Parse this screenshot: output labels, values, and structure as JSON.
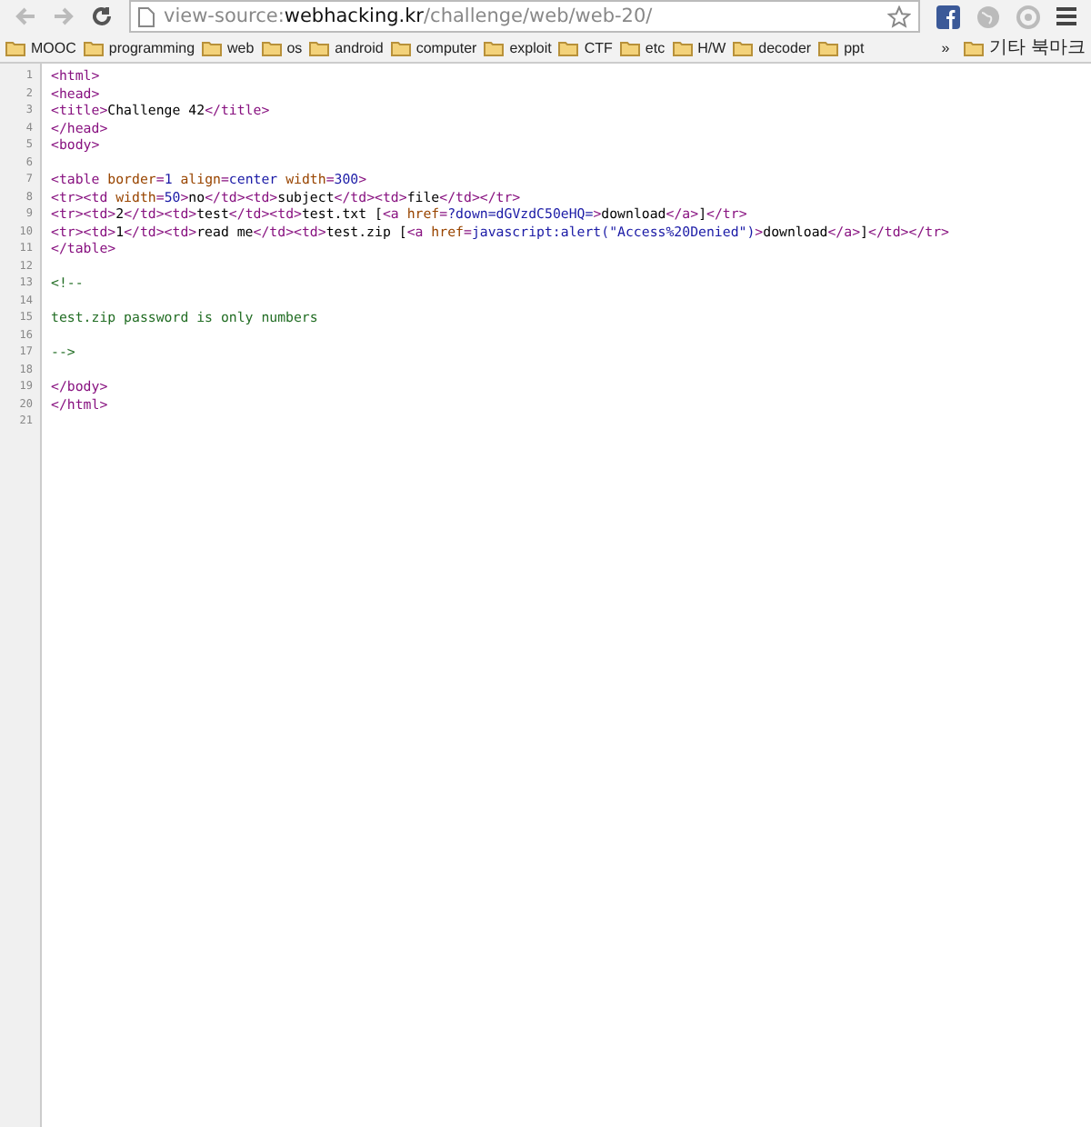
{
  "toolbar": {
    "address_scheme": "view-source:",
    "address_host": "webhacking.kr",
    "address_path": "/challenge/web/web-20/"
  },
  "bookmarks": [
    "MOOC",
    "programming",
    "web",
    "os",
    "android",
    "computer",
    "exploit",
    "CTF",
    "etc",
    "H/W",
    "decoder",
    "ppt"
  ],
  "bookmarks_overflow": "»",
  "other_bookmarks": "기타 북마크",
  "source_lines": [
    {
      "number": "1",
      "segments": [
        {
          "kind": "tag",
          "text": "<html>"
        }
      ]
    },
    {
      "number": "2",
      "segments": [
        {
          "kind": "tag",
          "text": "<head>"
        }
      ]
    },
    {
      "number": "3",
      "segments": [
        {
          "kind": "tag",
          "text": "<title>"
        },
        {
          "kind": "text",
          "text": "Challenge 42"
        },
        {
          "kind": "tag",
          "text": "</title>"
        }
      ]
    },
    {
      "number": "4",
      "segments": [
        {
          "kind": "tag",
          "text": "</head>"
        }
      ]
    },
    {
      "number": "5",
      "segments": [
        {
          "kind": "tag",
          "text": "<body>"
        }
      ]
    },
    {
      "number": "6"
    },
    {
      "number": "7",
      "segments": [
        {
          "kind": "tag",
          "text": "<table "
        },
        {
          "kind": "attr",
          "text": "border"
        },
        {
          "kind": "tag",
          "text": "="
        },
        {
          "kind": "value",
          "text": "1"
        },
        {
          "kind": "attr",
          "text": " align"
        },
        {
          "kind": "tag",
          "text": "="
        },
        {
          "kind": "value",
          "text": "center"
        },
        {
          "kind": "attr",
          "text": " width"
        },
        {
          "kind": "tag",
          "text": "="
        },
        {
          "kind": "value",
          "text": "300"
        },
        {
          "kind": "tag",
          "text": ">"
        }
      ]
    },
    {
      "number": "8",
      "segments": [
        {
          "kind": "tag",
          "text": "<tr><td "
        },
        {
          "kind": "attr",
          "text": "width"
        },
        {
          "kind": "tag",
          "text": "="
        },
        {
          "kind": "value",
          "text": "50"
        },
        {
          "kind": "tag",
          "text": ">"
        },
        {
          "kind": "text",
          "text": "no"
        },
        {
          "kind": "tag",
          "text": "</td><td>"
        },
        {
          "kind": "text",
          "text": "subject"
        },
        {
          "kind": "tag",
          "text": "</td><td>"
        },
        {
          "kind": "text",
          "text": "file"
        },
        {
          "kind": "tag",
          "text": "</td></tr>"
        }
      ]
    },
    {
      "number": "9",
      "segments": [
        {
          "kind": "tag",
          "text": "<tr><td>"
        },
        {
          "kind": "text",
          "text": "2"
        },
        {
          "kind": "tag",
          "text": "</td><td>"
        },
        {
          "kind": "text",
          "text": "test"
        },
        {
          "kind": "tag",
          "text": "</td><td>"
        },
        {
          "kind": "text",
          "text": "test.txt ["
        },
        {
          "kind": "tag",
          "text": "<a "
        },
        {
          "kind": "attr",
          "text": "href"
        },
        {
          "kind": "tag",
          "text": "="
        },
        {
          "kind": "link",
          "text": "?down=dGVzdC50eHQ="
        },
        {
          "kind": "tag",
          "text": ">"
        },
        {
          "kind": "text",
          "text": "download"
        },
        {
          "kind": "tag",
          "text": "</a>"
        },
        {
          "kind": "text",
          "text": "]"
        },
        {
          "kind": "tag",
          "text": "</tr>"
        }
      ]
    },
    {
      "number": "10",
      "segments": [
        {
          "kind": "tag",
          "text": "<tr><td>"
        },
        {
          "kind": "text",
          "text": "1"
        },
        {
          "kind": "tag",
          "text": "</td><td>"
        },
        {
          "kind": "text",
          "text": "read me"
        },
        {
          "kind": "tag",
          "text": "</td><td>"
        },
        {
          "kind": "text",
          "text": "test.zip ["
        },
        {
          "kind": "tag",
          "text": "<a "
        },
        {
          "kind": "attr",
          "text": "href"
        },
        {
          "kind": "tag",
          "text": "="
        },
        {
          "kind": "link",
          "text": "javascript:alert(\"Access%20Denied\")"
        },
        {
          "kind": "tag",
          "text": ">"
        },
        {
          "kind": "text",
          "text": "download"
        },
        {
          "kind": "tag",
          "text": "</a>"
        },
        {
          "kind": "text",
          "text": "]"
        },
        {
          "kind": "tag",
          "text": "</td></tr>"
        }
      ]
    },
    {
      "number": "11",
      "segments": [
        {
          "kind": "tag",
          "text": "</table>"
        }
      ]
    },
    {
      "number": "12"
    },
    {
      "number": "13",
      "segments": [
        {
          "kind": "comment",
          "text": "<!--"
        }
      ]
    },
    {
      "number": "14"
    },
    {
      "number": "15",
      "segments": [
        {
          "kind": "comment",
          "text": "test.zip password is only numbers"
        }
      ]
    },
    {
      "number": "16"
    },
    {
      "number": "17",
      "segments": [
        {
          "kind": "comment",
          "text": "-->"
        }
      ]
    },
    {
      "number": "18"
    },
    {
      "number": "19",
      "segments": [
        {
          "kind": "tag",
          "text": "</body>"
        }
      ]
    },
    {
      "number": "20",
      "segments": [
        {
          "kind": "tag",
          "text": "</html>"
        }
      ]
    },
    {
      "number": "21"
    }
  ]
}
